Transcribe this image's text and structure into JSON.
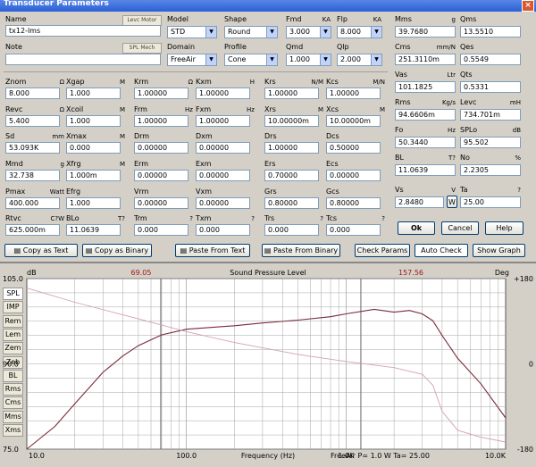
{
  "window": {
    "title": "Transducer Parameters",
    "close": "×"
  },
  "top": {
    "name_label": "Name",
    "name_value": "tx12-lms",
    "levc_button": "Levc Motor",
    "note_label": "Note",
    "spl_button": "SPL Mech",
    "model_label": "Model",
    "model_value": "STD",
    "shape_label": "Shape",
    "shape_value": "Round",
    "fmd_label": "Fmd",
    "fmd_unit": "KA",
    "fmd_value": "3.000",
    "flp_label": "Flp",
    "flp_unit": "KA",
    "flp_value": "8.000",
    "domain_label": "Domain",
    "domain_value": "FreeAir",
    "profile_label": "Profile",
    "profile_value": "Cone",
    "qmd_label": "Qmd",
    "qmd_value": "1.000",
    "qlp_label": "Qlp",
    "qlp_value": "2.000"
  },
  "params": [
    {
      "label": "Znom",
      "unit": "Ω",
      "value": "8.000"
    },
    {
      "label": "Xgap",
      "unit": "M",
      "value": "1.000"
    },
    {
      "label": "Krm",
      "unit": "Ω",
      "value": "1.00000"
    },
    {
      "label": "Kxm",
      "unit": "H",
      "value": "1.00000"
    },
    {
      "label": "Krs",
      "unit": "N/M",
      "value": "1.00000"
    },
    {
      "label": "Kcs",
      "unit": "M/N",
      "value": "1.00000"
    },
    {
      "label": "Revc",
      "unit": "Ω",
      "value": "5.400"
    },
    {
      "label": "Xcoil",
      "unit": "M",
      "value": "1.000"
    },
    {
      "label": "Frm",
      "unit": "Hz",
      "value": "1.00000"
    },
    {
      "label": "Fxm",
      "unit": "Hz",
      "value": "1.00000"
    },
    {
      "label": "Xrs",
      "unit": "M",
      "value": "10.00000m"
    },
    {
      "label": "Xcs",
      "unit": "M",
      "value": "10.00000m"
    },
    {
      "label": "Sd",
      "unit": "mm",
      "value": "53.093K"
    },
    {
      "label": "Xmax",
      "unit": "M",
      "value": "0.000"
    },
    {
      "label": "Drm",
      "unit": "",
      "value": "0.00000"
    },
    {
      "label": "Dxm",
      "unit": "",
      "value": "0.00000"
    },
    {
      "label": "Drs",
      "unit": "",
      "value": "1.00000"
    },
    {
      "label": "Dcs",
      "unit": "",
      "value": "0.50000"
    },
    {
      "label": "Mmd",
      "unit": "g",
      "value": "32.738"
    },
    {
      "label": "Xfrg",
      "unit": "M",
      "value": "1.000m"
    },
    {
      "label": "Erm",
      "unit": "",
      "value": "0.00000"
    },
    {
      "label": "Exm",
      "unit": "",
      "value": "0.00000"
    },
    {
      "label": "Ers",
      "unit": "",
      "value": "0.70000"
    },
    {
      "label": "Ecs",
      "unit": "",
      "value": "0.00000"
    },
    {
      "label": "Pmax",
      "unit": "Watt",
      "value": "400.000"
    },
    {
      "label": "Efrg",
      "unit": "",
      "value": "1.000"
    },
    {
      "label": "Vrm",
      "unit": "",
      "value": "0.00000"
    },
    {
      "label": "Vxm",
      "unit": "",
      "value": "0.00000"
    },
    {
      "label": "Grs",
      "unit": "",
      "value": "0.80000"
    },
    {
      "label": "Gcs",
      "unit": "",
      "value": "0.80000"
    },
    {
      "label": "Rtvc",
      "unit": "C?W",
      "value": "625.000m"
    },
    {
      "label": "BLo",
      "unit": "T?",
      "value": "11.0639"
    },
    {
      "label": "Trm",
      "unit": "?",
      "value": "0.000"
    },
    {
      "label": "Txm",
      "unit": "?",
      "value": "0.000"
    },
    {
      "label": "Trs",
      "unit": "?",
      "value": "0.000"
    },
    {
      "label": "Tcs",
      "unit": "?",
      "value": "0.000"
    }
  ],
  "right_params": [
    {
      "label": "Mms",
      "unit": "g",
      "value": "39.7680"
    },
    {
      "label": "Qms",
      "unit": "",
      "value": "13.5510"
    },
    {
      "label": "Cms",
      "unit": "mm/N",
      "value": "251.3110m"
    },
    {
      "label": "Qes",
      "unit": "",
      "value": "0.5549"
    },
    {
      "label": "Vas",
      "unit": "Ltr",
      "value": "101.1825"
    },
    {
      "label": "Qts",
      "unit": "",
      "value": "0.5331"
    },
    {
      "label": "Rms",
      "unit": "Kg/s",
      "value": "94.6606m"
    },
    {
      "label": "Levc",
      "unit": "mH",
      "value": "734.701m"
    },
    {
      "label": "Fo",
      "unit": "Hz",
      "value": "50.3440"
    },
    {
      "label": "SPLo",
      "unit": "dB",
      "value": "95.502"
    },
    {
      "label": "BL",
      "unit": "T?",
      "value": "11.0639"
    },
    {
      "label": "No",
      "unit": "%",
      "value": "2.2305"
    },
    {
      "label": "Vs",
      "unit": "V",
      "value": "2.8480"
    },
    {
      "label": "Ta",
      "unit": "?",
      "value": "25.00"
    }
  ],
  "buttons": {
    "ok": "Ok",
    "cancel": "Cancel",
    "help": "Help",
    "copy_text": "Copy as Text",
    "copy_binary": "Copy as Binary",
    "paste_text": "Paste From Text",
    "paste_binary": "Paste From Binary",
    "check_params": "Check Params",
    "auto_check": "Auto Check",
    "show_graph": "Show Graph",
    "vs_btn": "W"
  },
  "side_tabs": [
    "SPL",
    "IMP",
    "Rem",
    "Lem",
    "Zem",
    "Zeb",
    "BL",
    "Rms",
    "Cms",
    "Mms",
    "Xms"
  ],
  "chart_data": {
    "type": "line",
    "title": "Sound Pressure Level",
    "left_unit": "dB",
    "right_unit": "Deg",
    "marker_left": "69.05",
    "marker_right": "157.56",
    "xlabel": "Frequency (Hz)",
    "xticks": [
      "10.0",
      "100.0",
      "1.0K",
      "10.0K"
    ],
    "xlim": [
      10,
      10000
    ],
    "yleft_ticks": [
      "105.0",
      "90.0",
      "75.0"
    ],
    "ylim_left": [
      75,
      105
    ],
    "yright_ticks": [
      "+180",
      "0",
      "-180"
    ],
    "ylim_right": [
      -180,
      180
    ],
    "footer": "FreeAir  P=  1.0 W  Ta= 25.00",
    "series": [
      {
        "values_x": [
          10,
          15,
          20,
          30,
          40,
          50,
          70,
          100,
          200,
          300,
          500,
          800,
          1000,
          1500,
          2000,
          2500,
          3000,
          3500,
          4000,
          5000,
          7000,
          10000
        ],
        "values_y": [
          74,
          79,
          83,
          88.5,
          91.4,
          93.2,
          95.1,
          96.1,
          96.7,
          97.2,
          97.7,
          98.3,
          98.8,
          99.6,
          99.1,
          99.4,
          98.8,
          97.6,
          95,
          91,
          86.5,
          80.5
        ]
      },
      {
        "values_x": [
          10,
          20,
          50,
          100,
          200,
          500,
          1000,
          2000,
          3000,
          3500,
          4000,
          5000,
          7000,
          10000
        ],
        "values_y": [
          160,
          130,
          95,
          68,
          45,
          20,
          5,
          -8,
          -22,
          -45,
          -100,
          -140,
          -155,
          -165
        ]
      }
    ],
    "colors": {
      "spl": "#7a2a3a",
      "phase": "#d4a0b4",
      "grid": "#a6a6a6"
    }
  }
}
